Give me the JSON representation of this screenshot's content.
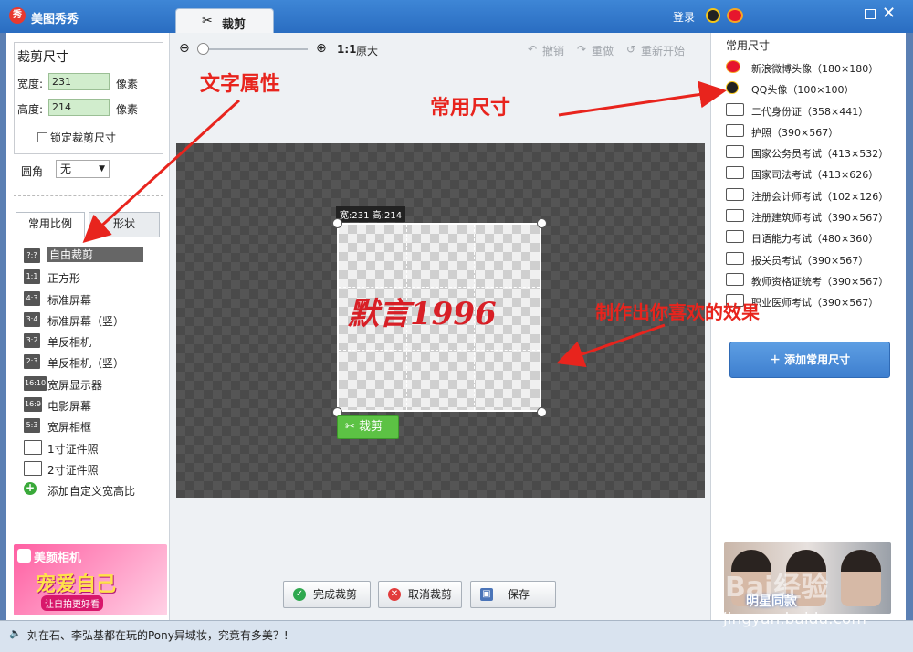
{
  "app": {
    "logo_text": "秀",
    "title": "美图秀秀",
    "tab_label": "裁剪",
    "login": "登录"
  },
  "left": {
    "crop_title": "裁剪尺寸",
    "width_label": "宽度:",
    "width_value": "231",
    "width_unit": "像素",
    "height_label": "高度:",
    "height_value": "214",
    "height_unit": "像素",
    "lock_label": "锁定裁剪尺寸",
    "corner_label": "圆角",
    "corner_value": "无",
    "tabs": [
      "常用比例",
      "形状"
    ],
    "ratios": [
      {
        "icon": "?:?",
        "label": "自由裁剪"
      },
      {
        "icon": "1:1",
        "label": "正方形"
      },
      {
        "icon": "4:3",
        "label": "标准屏幕"
      },
      {
        "icon": "3:4",
        "label": "标准屏幕（竖）"
      },
      {
        "icon": "3:2",
        "label": "单反相机"
      },
      {
        "icon": "2:3",
        "label": "单反相机（竖）"
      },
      {
        "icon": "16:10",
        "label": "宽屏显示器"
      },
      {
        "icon": "16:9",
        "label": "电影屏幕"
      },
      {
        "icon": "5:3",
        "label": "宽屏相框"
      },
      {
        "icon": "",
        "label": "1寸证件照"
      },
      {
        "icon": "",
        "label": "2寸证件照"
      },
      {
        "icon": "+",
        "label": "添加自定义宽高比"
      }
    ],
    "ad": {
      "brand": "美颜相机",
      "main": "宠爱自己",
      "sub": "让自拍更好看"
    }
  },
  "toolbar": {
    "ratio": "1:1",
    "original": "原大",
    "undo": "撤销",
    "redo": "重做",
    "restart": "重新开始"
  },
  "canvas": {
    "size_tag": "宽:231 高:214",
    "watermark": "默言1996",
    "crop_button": "裁剪"
  },
  "actions": {
    "finish": "完成裁剪",
    "cancel": "取消裁剪",
    "save": "保存"
  },
  "right": {
    "title": "常用尺寸",
    "sizes": [
      {
        "icon": "weibo",
        "label": "新浪微博头像（180×180）"
      },
      {
        "icon": "qq",
        "label": "QQ头像（100×100）"
      },
      {
        "icon": "card",
        "label": "二代身份证（358×441）"
      },
      {
        "icon": "card",
        "label": "护照（390×567）"
      },
      {
        "icon": "card",
        "label": "国家公务员考试（413×532）"
      },
      {
        "icon": "card",
        "label": "国家司法考试（413×626）"
      },
      {
        "icon": "card",
        "label": "注册会计师考试（102×126）"
      },
      {
        "icon": "card",
        "label": "注册建筑师考试（390×567）"
      },
      {
        "icon": "card",
        "label": "日语能力考试（480×360）"
      },
      {
        "icon": "card",
        "label": "报关员考试（390×567）"
      },
      {
        "icon": "card",
        "label": "教师资格证统考（390×567）"
      },
      {
        "icon": "card",
        "label": "职业医师考试（390×567）"
      }
    ],
    "add_button": "添加常用尺寸",
    "ad_text": "明星同款"
  },
  "annotations": {
    "text_attr": "文字属性",
    "common_size": "常用尺寸",
    "effect": "制作出你喜欢的效果"
  },
  "status": {
    "text": "刘在石、李弘基都在玩的Pony异域妆，究竟有多美？!"
  },
  "watermark": {
    "brand": "Bai经验",
    "url": "jingyan.baidu.com"
  },
  "colors": {
    "accent": "#3e86d6",
    "annotation": "#e8241d",
    "input_bg": "#d1edcd",
    "crop_green": "#5cc244"
  }
}
